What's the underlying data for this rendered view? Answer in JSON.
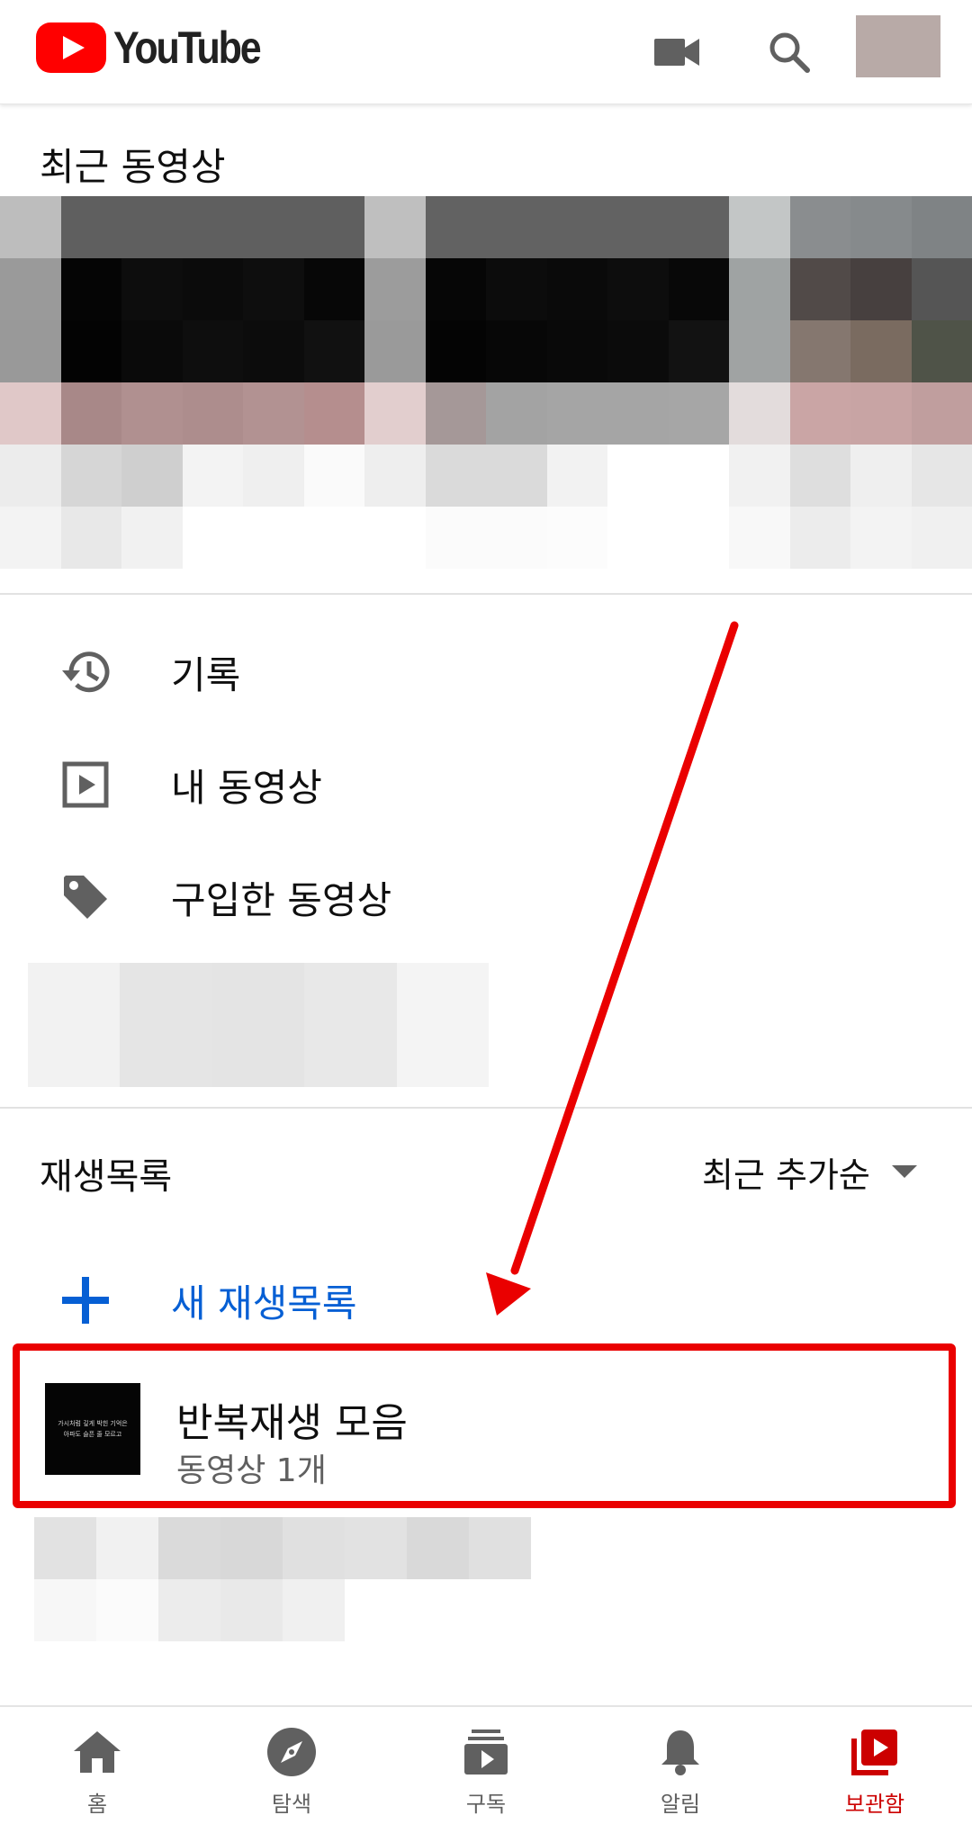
{
  "header": {
    "logo_text": "YouTube",
    "icons": [
      "video-camera-icon",
      "search-icon"
    ],
    "accent": "#ff0000"
  },
  "recent": {
    "title": "최근 동영상"
  },
  "library": {
    "items": [
      {
        "label": "기록",
        "icon": "history-icon"
      },
      {
        "label": "내 동영상",
        "icon": "play-box-icon"
      },
      {
        "label": "구입한 동영상",
        "icon": "tag-icon"
      }
    ]
  },
  "playlists": {
    "title": "재생목록",
    "sort_label": "최근 추가순",
    "new_label": "새 재생목록",
    "items": [
      {
        "title": "반복재생 모음",
        "meta": "동영상 1개",
        "thumb_lines": [
          "가시처럼 깊게 박힌 기억은",
          "아파도 슬픈 줄 모르고"
        ]
      }
    ]
  },
  "annotation": {
    "color": "#ea0000"
  },
  "nav": {
    "items": [
      {
        "label": "홈",
        "icon": "home-icon",
        "active": false
      },
      {
        "label": "탐색",
        "icon": "explore-compass-icon",
        "active": false
      },
      {
        "label": "구독",
        "icon": "subscriptions-icon",
        "active": false
      },
      {
        "label": "알림",
        "icon": "bell-icon",
        "active": false
      },
      {
        "label": "보관함",
        "icon": "library-icon",
        "active": true
      }
    ],
    "active_color": "#cc0000"
  }
}
